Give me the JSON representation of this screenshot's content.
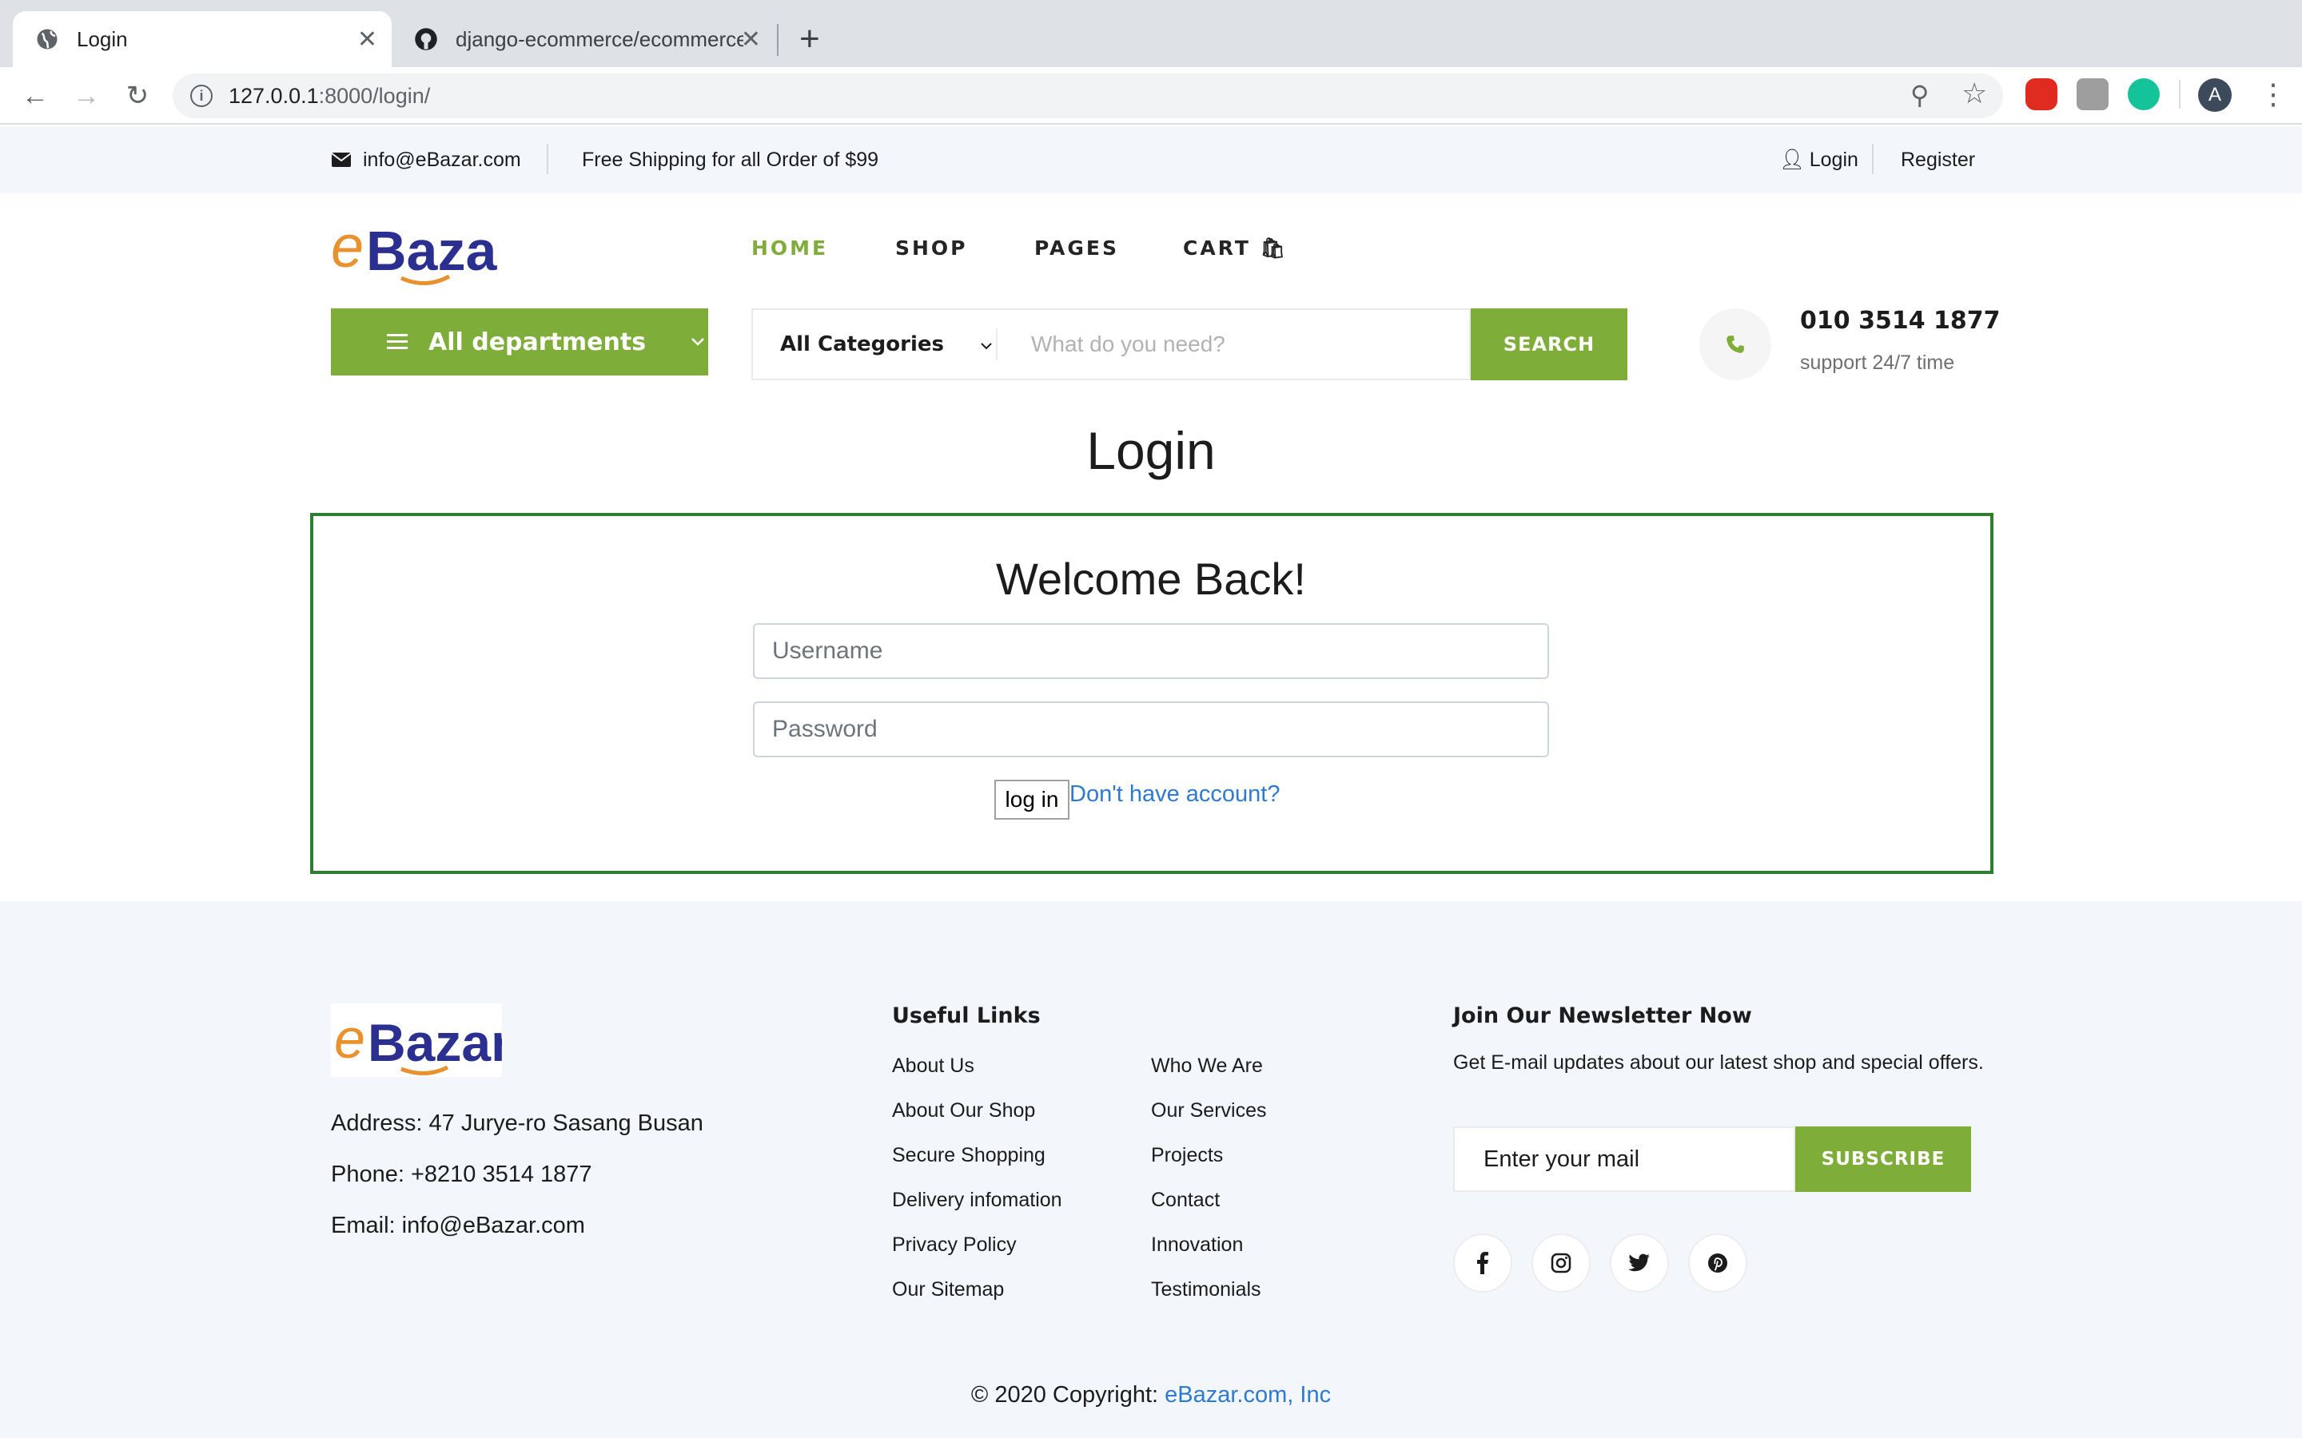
{
  "browser": {
    "tabs": [
      {
        "title": "Login",
        "active": true
      },
      {
        "title": "django-ecommerce/ecommerce",
        "active": false
      }
    ],
    "url_host": "127.0.0.1",
    "url_path": ":8000/login/",
    "profile_initial": "A"
  },
  "topbar": {
    "email": "info@eBazar.com",
    "shipping": "Free Shipping for all Order of $99",
    "login": "Login",
    "register": "Register"
  },
  "brand": {
    "logo_e": "e",
    "logo_rest": "Bazar",
    "accent": "#7fad39"
  },
  "nav": {
    "home": "HOME",
    "shop": "SHOP",
    "pages": "PAGES",
    "cart": "CART"
  },
  "departments": {
    "label": "All departments"
  },
  "search": {
    "category": "All Categories",
    "placeholder": "What do you need?",
    "button": "SEARCH"
  },
  "contact": {
    "phone": "010 3514 1877",
    "support": "support 24/7 time"
  },
  "login": {
    "page_title": "Login",
    "welcome": "Welcome Back!",
    "username_placeholder": "Username",
    "password_placeholder": "Password",
    "button": "log in",
    "signup_link": "Don't have account?"
  },
  "footer": {
    "address": "Address: 47 Jurye-ro Sasang Busan",
    "phone": "Phone: +8210 3514 1877",
    "email": "Email: info@eBazar.com",
    "useful_links_title": "Useful Links",
    "links_col1": [
      "About Us",
      "About Our Shop",
      "Secure Shopping",
      "Delivery infomation",
      "Privacy Policy",
      "Our Sitemap"
    ],
    "links_col2": [
      "Who We Are",
      "Our Services",
      "Projects",
      "Contact",
      "Innovation",
      "Testimonials"
    ],
    "newsletter_title": "Join Our Newsletter Now",
    "newsletter_desc": "Get E-mail updates about our latest shop and special offers.",
    "mail_placeholder": "Enter your mail",
    "subscribe": "SUBSCRIBE",
    "social": [
      "facebook-icon",
      "instagram-icon",
      "twitter-icon",
      "pinterest-icon"
    ],
    "copyright_prefix": "© 2020 Copyright: ",
    "copyright_link": "eBazar.com, Inc"
  }
}
